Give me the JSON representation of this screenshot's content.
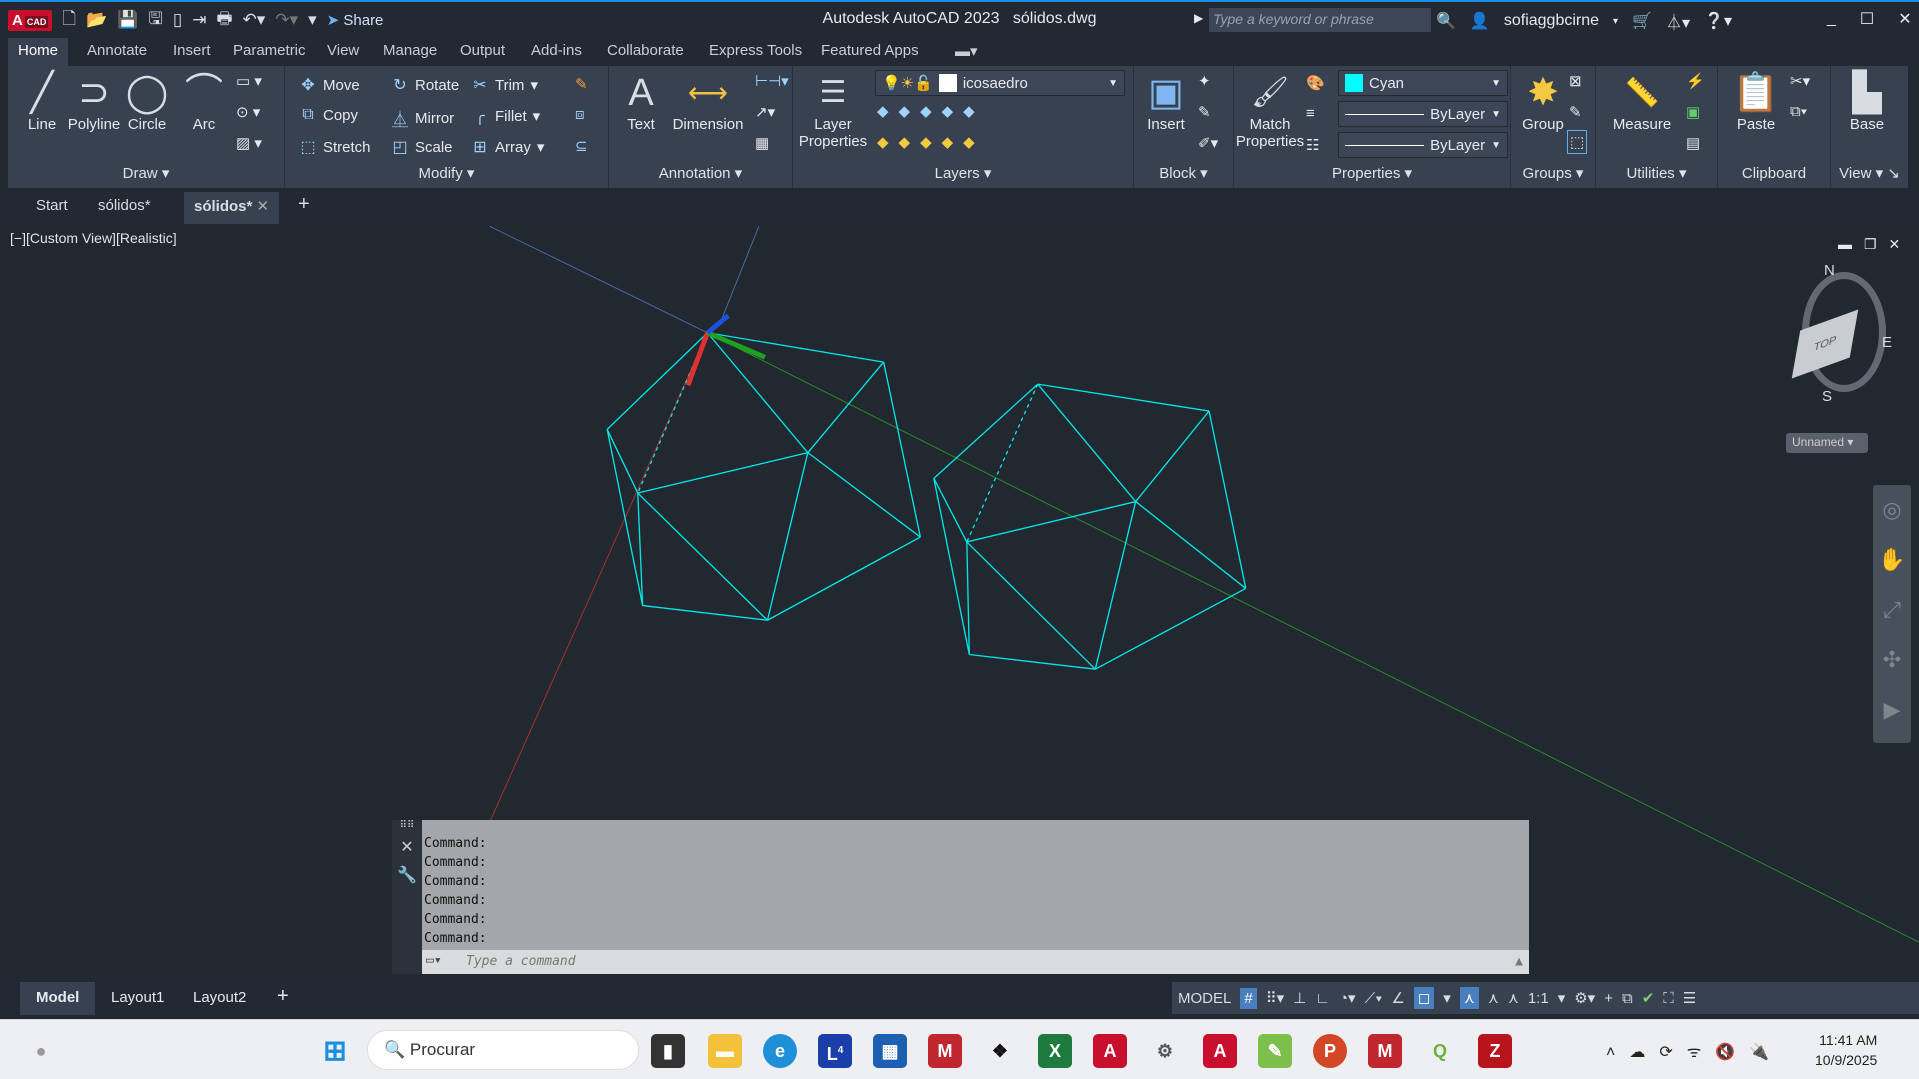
{
  "titlebar": {
    "app_logo": "A",
    "app_logo_sub": "CAD",
    "share": "Share",
    "title": "Autodesk AutoCAD 2023",
    "file": "sólidos.dwg",
    "search_placeholder": "Type a keyword or phrase",
    "user": "sofiaggbcirne"
  },
  "ribbon_tabs": [
    "Home",
    "Annotate",
    "Insert",
    "Parametric",
    "View",
    "Manage",
    "Output",
    "Add-ins",
    "Collaborate",
    "Express Tools",
    "Featured Apps"
  ],
  "ribbon": {
    "draw": {
      "title": "Draw",
      "line": "Line",
      "polyline": "Polyline",
      "circle": "Circle",
      "arc": "Arc"
    },
    "modify": {
      "title": "Modify",
      "move": "Move",
      "rotate": "Rotate",
      "trim": "Trim",
      "copy": "Copy",
      "mirror": "Mirror",
      "fillet": "Fillet",
      "stretch": "Stretch",
      "scale": "Scale",
      "array": "Array"
    },
    "annotation": {
      "title": "Annotation",
      "text": "Text",
      "dimension": "Dimension"
    },
    "layers": {
      "title": "Layers",
      "layer_properties_1": "Layer",
      "layer_properties_2": "Properties",
      "current_layer": "icosaedro"
    },
    "block": {
      "title": "Block",
      "insert": "Insert"
    },
    "properties": {
      "title": "Properties",
      "match_1": "Match",
      "match_2": "Properties",
      "color": "Cyan",
      "color_hex": "#00ffff",
      "linetype": "ByLayer",
      "lineweight": "ByLayer"
    },
    "groups": {
      "title": "Groups",
      "group": "Group"
    },
    "utilities": {
      "title": "Utilities",
      "measure": "Measure"
    },
    "clipboard": {
      "title": "Clipboard",
      "paste": "Paste"
    },
    "view": {
      "title": "View",
      "base": "Base"
    }
  },
  "file_tabs": [
    "Start",
    "sólidos*",
    "sólidos*"
  ],
  "viewport": {
    "label": "[−][Custom View][Realistic]",
    "viewcube_top": "TOP",
    "compass_n": "N",
    "compass_e": "E",
    "compass_s": "S",
    "ucs_name": "Unnamed",
    "geometry_color": "#00e5e5"
  },
  "command": {
    "history": [
      "Command:",
      "Command:",
      "Command:",
      "Command:",
      "Command:",
      "Command:"
    ],
    "placeholder": "Type a command"
  },
  "layout_tabs": [
    "Model",
    "Layout1",
    "Layout2"
  ],
  "status": {
    "model": "MODEL",
    "scale": "1:1"
  },
  "taskbar": {
    "search": "Procurar",
    "badge": "4",
    "time": "11:41 AM",
    "date": "10/9/2025"
  }
}
